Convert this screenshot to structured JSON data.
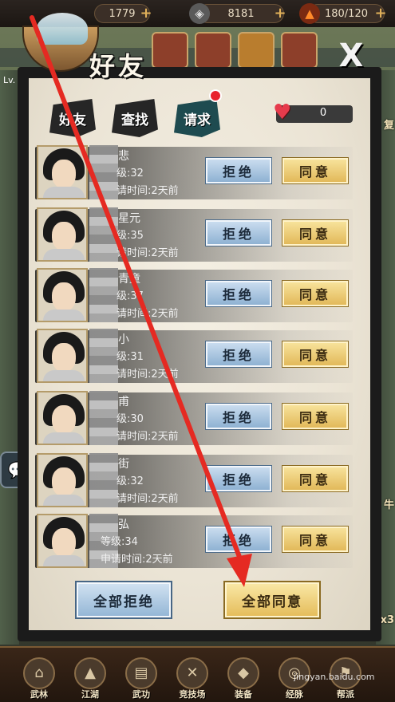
{
  "topbar": {
    "stamina": "1779",
    "coins": "8181",
    "energy": "180/120"
  },
  "left_hud": {
    "level_label": "Lv."
  },
  "dialog": {
    "title": "好友",
    "close_label": "X",
    "tabs": [
      {
        "label": "好友",
        "active": false
      },
      {
        "label": "查找",
        "active": false
      },
      {
        "label": "请求",
        "active": true
      }
    ],
    "heart_count": "0"
  },
  "requests": [
    {
      "name": "悲",
      "level": "级:32",
      "time": "请时间:2天前"
    },
    {
      "name": "星元",
      "level": "级:35",
      "time": "请时间:2天前"
    },
    {
      "name": "青童",
      "level": "级:37",
      "time": "请时间:2天前"
    },
    {
      "name": "小",
      "level": "级:31",
      "time": "请时间:2天前"
    },
    {
      "name": "甫",
      "level": "级:30",
      "time": "请时间:2天前"
    },
    {
      "name": "街",
      "level": "级:32",
      "time": "请时间:2天前"
    },
    {
      "name": "弘",
      "level": "等级:34",
      "time": "申请时间:2天前"
    }
  ],
  "labels": {
    "reject": "拒绝",
    "accept": "同意",
    "reject_all": "全部拒绝",
    "accept_all": "全部同意"
  },
  "side_right": {
    "tag_top": "复",
    "tag_mid": "牛",
    "tag_bottom": "x3"
  },
  "bottom_nav": [
    {
      "label": "武林",
      "icon": "tower-icon"
    },
    {
      "label": "江湖",
      "icon": "hat-icon"
    },
    {
      "label": "武功",
      "icon": "book-icon"
    },
    {
      "label": "竞技场",
      "icon": "swords-icon"
    },
    {
      "label": "装备",
      "icon": "armor-icon"
    },
    {
      "label": "经脉",
      "icon": "meridian-icon"
    },
    {
      "label": "帮派",
      "icon": "flag-icon"
    }
  ],
  "watermark": "jingyan.baidu.com",
  "colors": {
    "accept_gold": "#e2b95a",
    "reject_blue": "#8fb2d3",
    "arrow_red": "#e52a22",
    "notify_red": "#e8222c"
  }
}
